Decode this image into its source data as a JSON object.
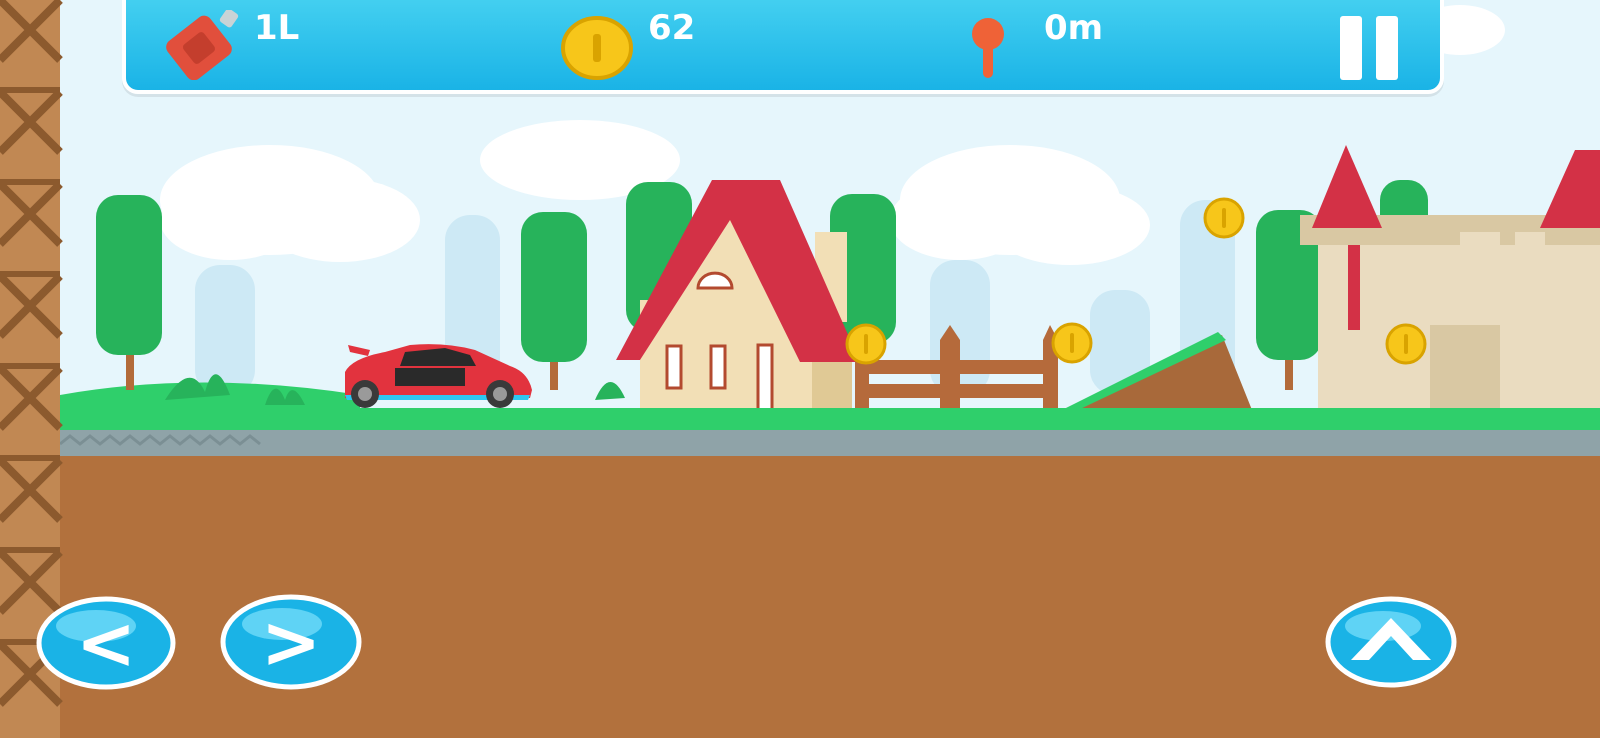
{
  "hud": {
    "fuel_value": "1L",
    "coins_value": "62",
    "distance_value": "0m",
    "fuel_icon": "fuel-can-icon",
    "coin_icon": "coin-icon",
    "distance_icon": "distance-pin-icon",
    "pause_icon": "pause-icon"
  },
  "controls": {
    "left_button_label": "<",
    "right_button_label": ">",
    "jump_icon": "chevron-up-icon"
  },
  "colors": {
    "sky": "#e8f6fc",
    "grass": "#2fcf6b",
    "dirt": "#b2713d",
    "hud": "#1ab3e6",
    "roof": "#d33146",
    "car": "#e2333e",
    "coin": "#f7c61a"
  }
}
